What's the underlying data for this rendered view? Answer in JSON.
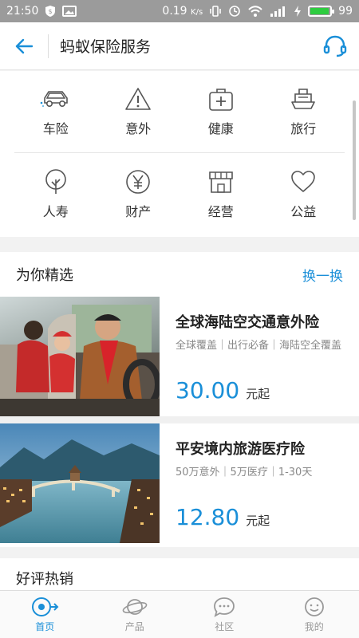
{
  "status_bar": {
    "time": "21:50",
    "speed": "0.19",
    "speed_unit": "K/s",
    "battery": "99"
  },
  "header": {
    "title": "蚂蚁保险服务"
  },
  "categories": [
    [
      {
        "label": "车险",
        "icon": "car-icon"
      },
      {
        "label": "意外",
        "icon": "warning-icon"
      },
      {
        "label": "健康",
        "icon": "medical-kit-icon"
      },
      {
        "label": "旅行",
        "icon": "ship-icon"
      }
    ],
    [
      {
        "label": "人寿",
        "icon": "tree-icon"
      },
      {
        "label": "财产",
        "icon": "yen-icon"
      },
      {
        "label": "经营",
        "icon": "shop-icon"
      },
      {
        "label": "公益",
        "icon": "heart-icon"
      }
    ]
  ],
  "picks": {
    "title": "为你精选",
    "swap_label": "换一换",
    "items": [
      {
        "name": "全球海陆空交通意外险",
        "tags": "全球覆盖｜出行必备｜海陆空全覆盖",
        "price": "30.00",
        "unit": "元起"
      },
      {
        "name": "平安境内旅游医疗险",
        "tags": "50万意外｜5万医疗｜1-30天",
        "price": "12.80",
        "unit": "元起"
      }
    ]
  },
  "bestseller": {
    "title": "好评热销"
  },
  "tabs": [
    {
      "label": "首页",
      "icon": "home-icon",
      "active": true
    },
    {
      "label": "产品",
      "icon": "planet-icon",
      "active": false
    },
    {
      "label": "社区",
      "icon": "chat-icon",
      "active": false
    },
    {
      "label": "我的",
      "icon": "smile-icon",
      "active": false
    }
  ],
  "colors": {
    "accent": "#1a8fd8",
    "status_bar": "#9b9b9b",
    "battery": "#2ecc40"
  }
}
